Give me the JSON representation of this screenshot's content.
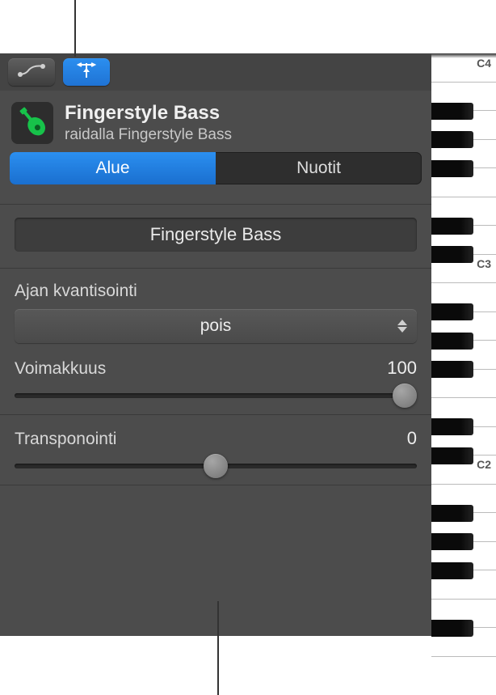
{
  "header": {
    "region_title": "Fingerstyle Bass",
    "track_prefix": "raidalla Fingerstyle Bass"
  },
  "tabs": {
    "region": "Alue",
    "notes": "Nuotit"
  },
  "name_field": {
    "value": "Fingerstyle Bass"
  },
  "quantize": {
    "label": "Ajan kvantisointi",
    "value": "pois"
  },
  "strength": {
    "label": "Voimakkuus",
    "value": "100",
    "percent": 100
  },
  "transpose": {
    "label": "Transponointi",
    "value": "0",
    "percent": 50
  },
  "piano": {
    "labels": [
      "C4",
      "C3",
      "C2"
    ]
  },
  "icons": {
    "automation": "automation-icon",
    "catch": "catch-icon",
    "bass": "bass-icon"
  }
}
